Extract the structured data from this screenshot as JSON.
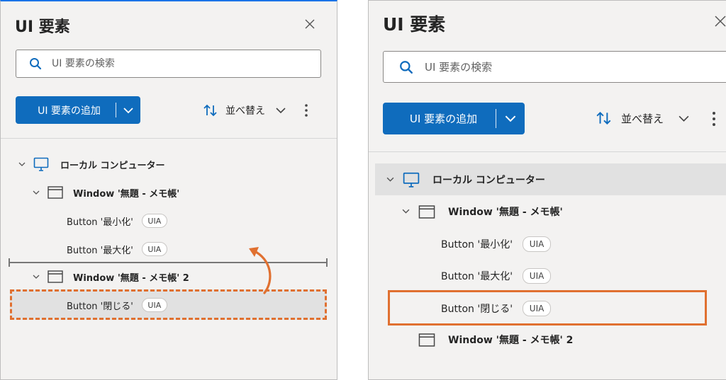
{
  "left": {
    "title": "UI 要素",
    "search_placeholder": "UI 要素の検索",
    "add_button_label": "UI 要素の追加",
    "sort_label": "並べ替え",
    "tree": {
      "root": "ローカル コンピューター",
      "window1": "Window '無題 - メモ帳'",
      "minimize": "Button '最小化'",
      "maximize": "Button '最大化'",
      "window2": "Window '無題 - メモ帳' 2",
      "close": "Button '閉じる'"
    },
    "badge": "UIA"
  },
  "right": {
    "title": "UI 要素",
    "search_placeholder": "UI 要素の検索",
    "add_button_label": "UI 要素の追加",
    "sort_label": "並べ替え",
    "tree": {
      "root": "ローカル コンピューター",
      "window1": "Window '無題 - メモ帳'",
      "minimize": "Button '最小化'",
      "maximize": "Button '最大化'",
      "close": "Button '閉じる'",
      "window2": "Window '無題 - メモ帳' 2"
    },
    "badge": "UIA"
  },
  "colors": {
    "accent": "#0f6cbd",
    "highlight": "#e07030",
    "panel_bg": "#f3f2f1",
    "selected_row": "#e0e0e0"
  },
  "icons": [
    "search-icon",
    "close-icon",
    "chevron-down-icon",
    "sort-icon",
    "more-icon",
    "computer-icon",
    "window-icon"
  ]
}
